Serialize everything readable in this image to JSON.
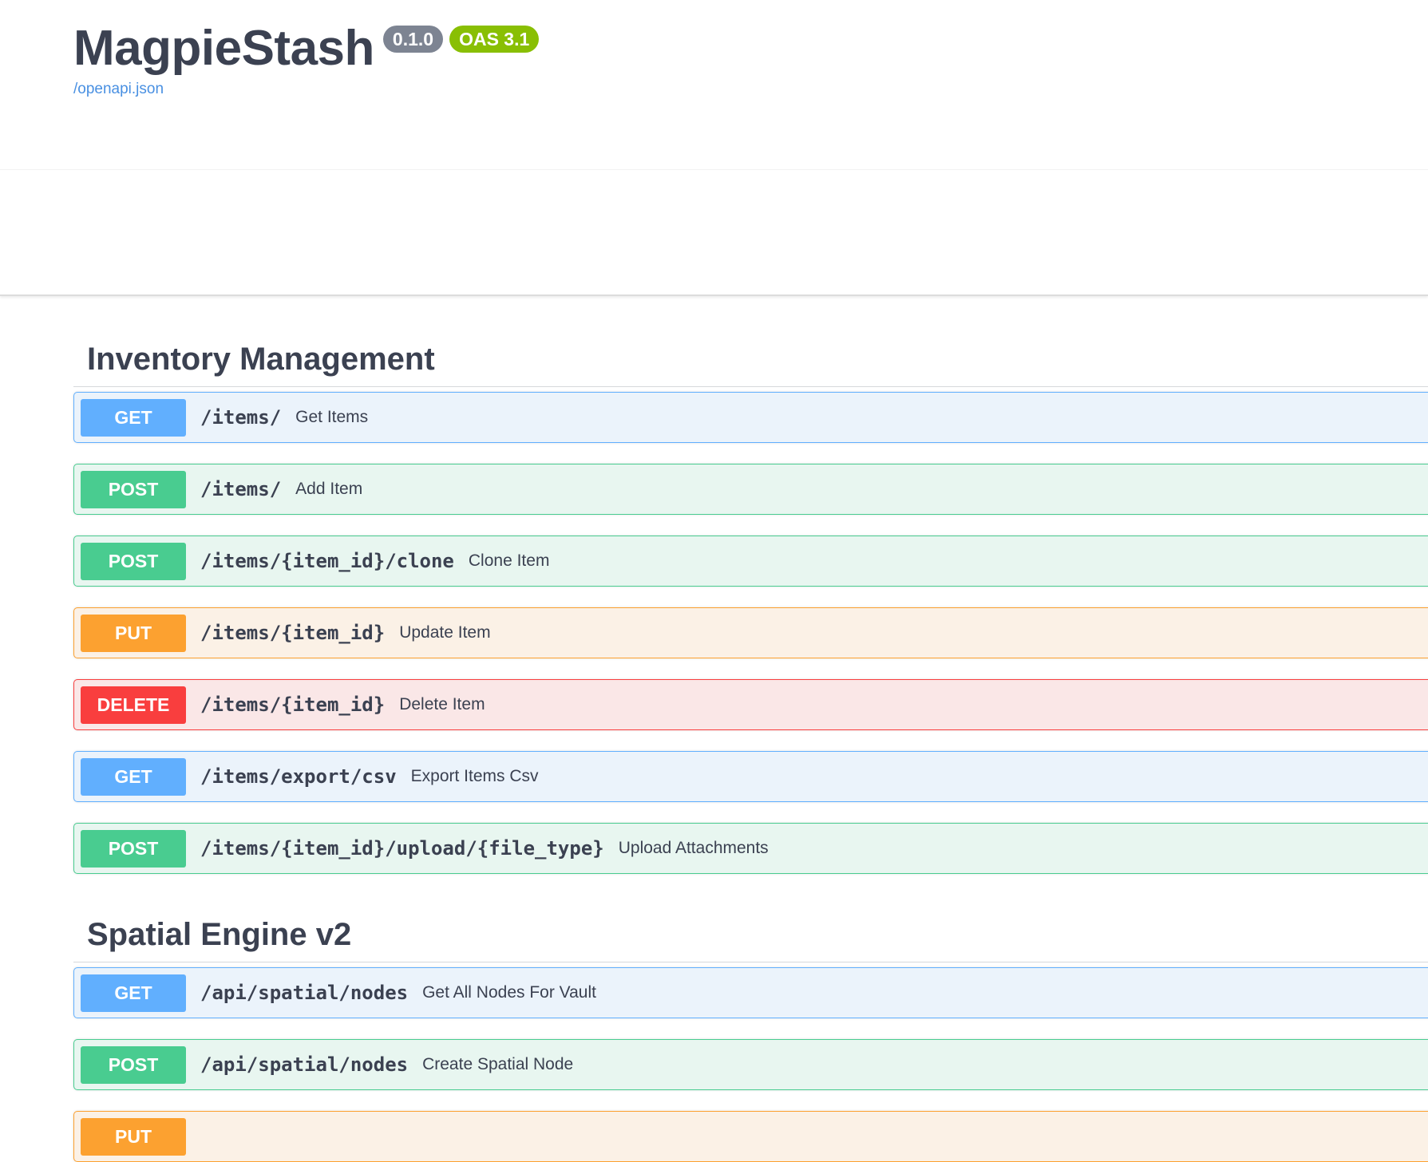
{
  "info": {
    "title": "MagpieStash",
    "version": "0.1.0",
    "oas_version": "OAS 3.1",
    "spec_link": "/openapi.json"
  },
  "sections": [
    {
      "name": "Inventory Management",
      "operations": [
        {
          "method": "GET",
          "path": "/items/",
          "summary": "Get Items"
        },
        {
          "method": "POST",
          "path": "/items/",
          "summary": "Add Item"
        },
        {
          "method": "POST",
          "path": "/items/{item_id}/clone",
          "summary": "Clone Item"
        },
        {
          "method": "PUT",
          "path": "/items/{item_id}",
          "summary": "Update Item"
        },
        {
          "method": "DELETE",
          "path": "/items/{item_id}",
          "summary": "Delete Item"
        },
        {
          "method": "GET",
          "path": "/items/export/csv",
          "summary": "Export Items Csv"
        },
        {
          "method": "POST",
          "path": "/items/{item_id}/upload/{file_type}",
          "summary": "Upload Attachments"
        }
      ]
    },
    {
      "name": "Spatial Engine v2",
      "operations": [
        {
          "method": "GET",
          "path": "/api/spatial/nodes",
          "summary": "Get All Nodes For Vault"
        },
        {
          "method": "POST",
          "path": "/api/spatial/nodes",
          "summary": "Create Spatial Node"
        },
        {
          "method": "PUT",
          "path": "",
          "summary": ""
        }
      ]
    }
  ],
  "colors": {
    "get": "#61affe",
    "post": "#49cc90",
    "put": "#fca130",
    "delete": "#f93e3e",
    "link": "#4990e2",
    "text": "#3b4151"
  }
}
